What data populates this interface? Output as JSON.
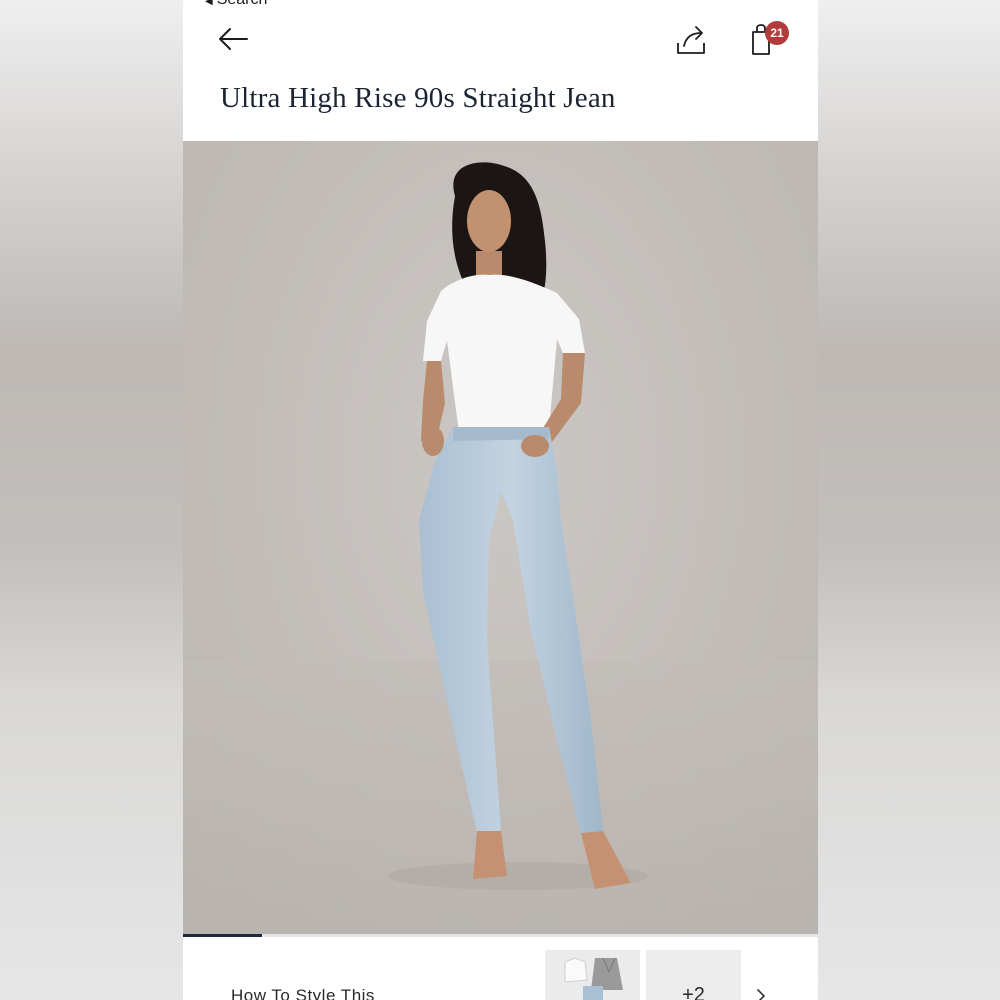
{
  "status_bar": {
    "back_label": "Search"
  },
  "header": {
    "cart_count": "21"
  },
  "product": {
    "title": "Ultra High Rise 90s Straight Jean",
    "image_count": 8,
    "current_image": 1
  },
  "style_section": {
    "label": "How To Style This",
    "more_count": "+2"
  },
  "colors": {
    "badge": "#b33a3a",
    "title_text": "#1a2433",
    "progress": "#1d2a3e"
  },
  "icons": [
    "back-arrow-icon",
    "share-icon",
    "shopping-bag-icon",
    "chevron-right-icon"
  ]
}
